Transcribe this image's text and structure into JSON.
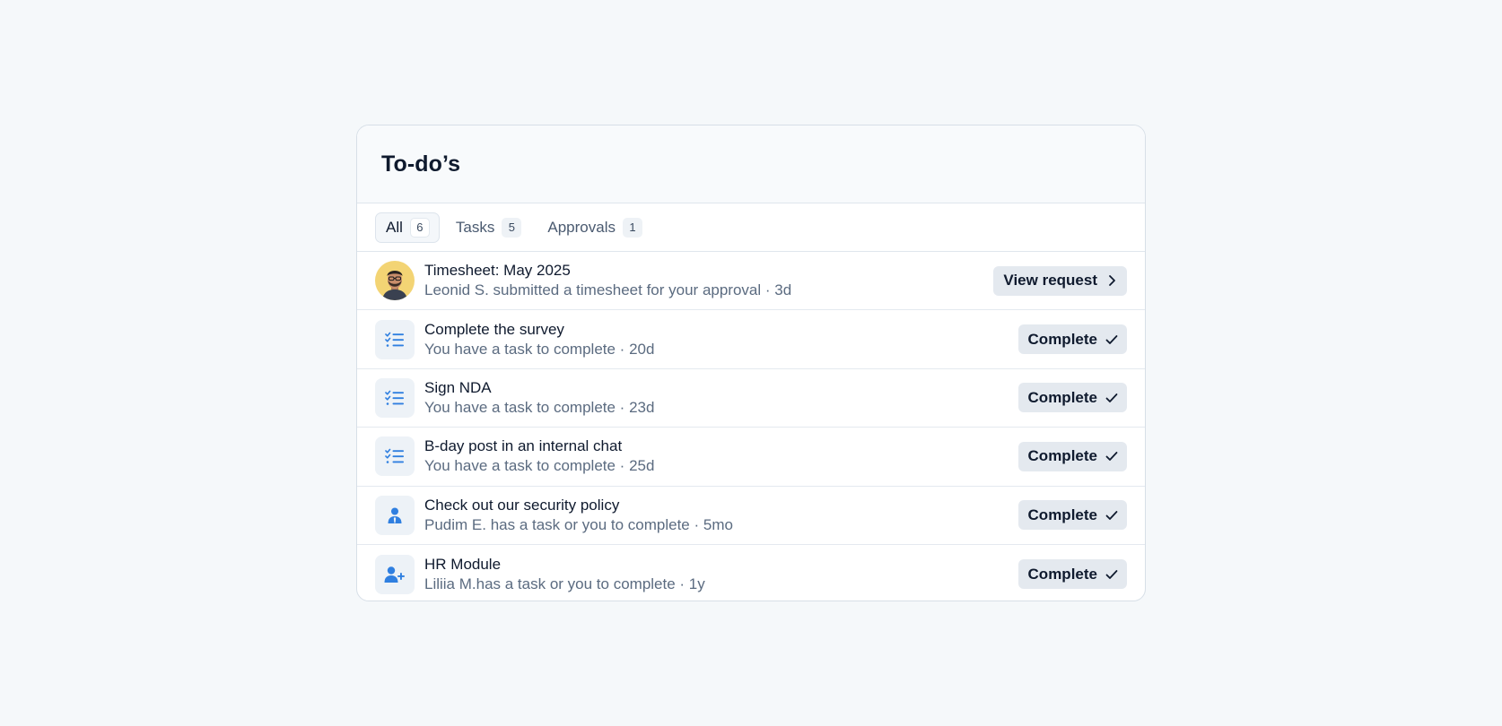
{
  "card": {
    "title": "To-do’s"
  },
  "tabs": [
    {
      "label": "All",
      "count": "6",
      "active": true
    },
    {
      "label": "Tasks",
      "count": "5",
      "active": false
    },
    {
      "label": "Approvals",
      "count": "1",
      "active": false
    }
  ],
  "items": [
    {
      "icon": "avatar",
      "title": "Timesheet: May 2025",
      "subtitle": "Leonid S. submitted a timesheet for your approval · 3d",
      "action": "View request",
      "action_icon": "chevron-right-icon"
    },
    {
      "icon": "task-list-icon",
      "title": "Complete the survey",
      "subtitle": "You have a task to complete · 20d",
      "action": "Complete",
      "action_icon": "check-icon"
    },
    {
      "icon": "task-list-icon",
      "title": "Sign NDA",
      "subtitle": "You have a task to complete · 23d",
      "action": "Complete",
      "action_icon": "check-icon"
    },
    {
      "icon": "task-list-icon",
      "title": "B-day post in an internal chat",
      "subtitle": "You have a task to complete · 25d",
      "action": "Complete",
      "action_icon": "check-icon"
    },
    {
      "icon": "user-tie-icon",
      "title": "Check out our security policy",
      "subtitle": "Pudim E. has a task or you to complete · 5mo",
      "action": "Complete",
      "action_icon": "check-icon"
    },
    {
      "icon": "user-plus-icon",
      "title": "HR Module",
      "subtitle": "Liliia M.has a task or you to complete · 1y",
      "action": "Complete",
      "action_icon": "check-icon"
    }
  ],
  "colors": {
    "accent": "#2f7fe0",
    "background": "#f5f8fa",
    "button_bg": "#e4e9ef"
  }
}
